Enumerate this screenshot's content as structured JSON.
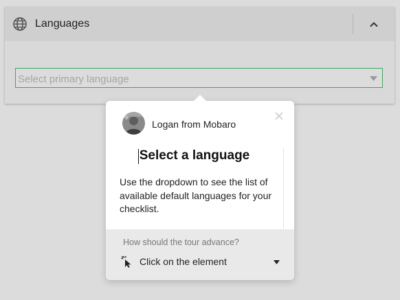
{
  "card": {
    "title": "Languages",
    "select_placeholder": "Select primary language"
  },
  "tour": {
    "author": "Logan from Mobaro",
    "title": "Select a language",
    "body": "Use the dropdown to see the list of available default languages for your checklist.",
    "advance_question": "How should the tour advance?",
    "advance_option": "Click on the element"
  },
  "colors": {
    "select_border": "#3aa55f",
    "background": "#dcdcdc",
    "header_bg": "#cfcfcf"
  },
  "icons": [
    "globe-icon",
    "chevron-up-icon",
    "chevron-down-icon",
    "close-icon",
    "click-pointer-icon",
    "caret-down-icon"
  ]
}
